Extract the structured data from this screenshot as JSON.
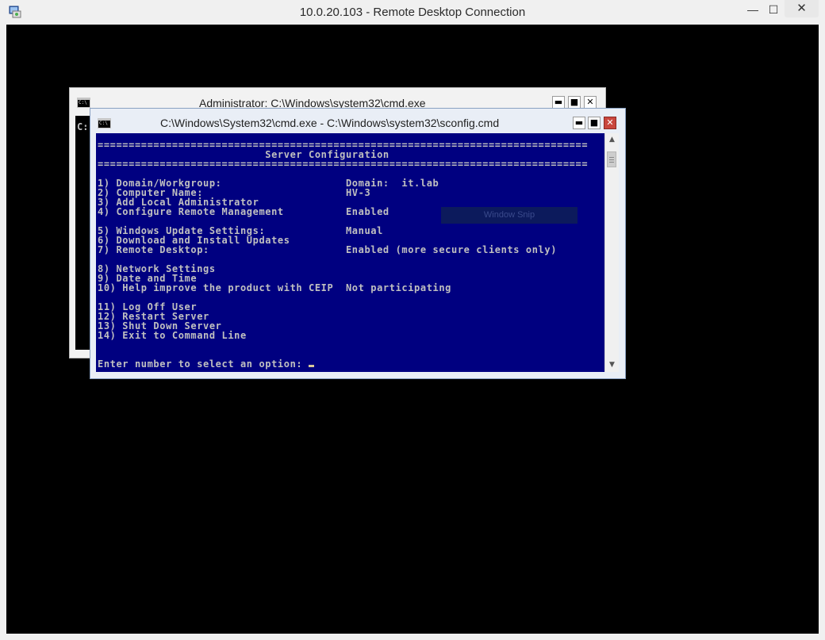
{
  "rdp": {
    "title": "10.0.20.103 - Remote Desktop Connection",
    "icon": "remote-desktop-icon",
    "controls": {
      "minimize": "—",
      "maximize": "☐",
      "close": "✕"
    }
  },
  "admin_window": {
    "title": "Administrator: C:\\Windows\\system32\\cmd.exe",
    "console_prompt": "C:",
    "controls": {
      "minimize": "▬",
      "maximize": "■",
      "close": "✕"
    }
  },
  "sconfig_window": {
    "title": "C:\\Windows\\System32\\cmd.exe - C:\\Windows\\system32\\sconfig.cmd",
    "controls": {
      "minimize": "▬",
      "maximize": "■",
      "close": "✕"
    },
    "console_lines": [
      "===============================================================================",
      "                           Server Configuration",
      "===============================================================================",
      "",
      "1) Domain/Workgroup:                    Domain:  it.lab",
      "2) Computer Name:                       HV-3",
      "3) Add Local Administrator",
      "4) Configure Remote Management          Enabled",
      "",
      "5) Windows Update Settings:             Manual",
      "6) Download and Install Updates",
      "7) Remote Desktop:                      Enabled (more secure clients only)",
      "",
      "8) Network Settings",
      "9) Date and Time",
      "10) Help improve the product with CEIP  Not participating",
      "",
      "11) Log Off User",
      "12) Restart Server",
      "13) Shut Down Server",
      "14) Exit to Command Line",
      "",
      "",
      "Enter number to select an option: "
    ],
    "overlay_label": "Window Snip"
  },
  "colors": {
    "console_bg": "#000080",
    "console_fg": "#c0c0c0",
    "desktop_bg": "#000000",
    "close_button": "#c9463d"
  }
}
